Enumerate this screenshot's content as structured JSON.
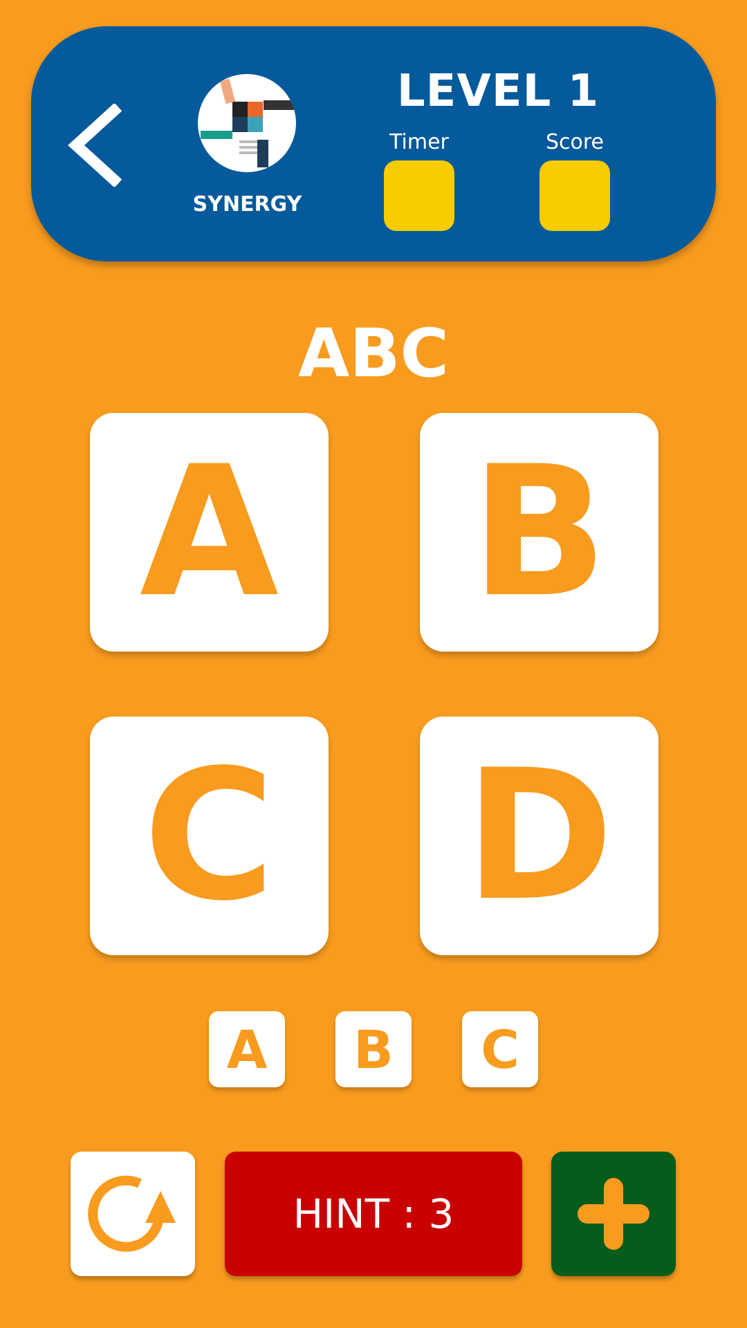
{
  "header": {
    "category_label": "SYNERGY",
    "level_title": "LEVEL 1",
    "timer_label": "Timer",
    "score_label": "Score",
    "timer_value": "",
    "score_value": ""
  },
  "question": {
    "word": "ABC"
  },
  "options": [
    "A",
    "B",
    "C",
    "D"
  ],
  "answer_slots": [
    "A",
    "B",
    "C"
  ],
  "controls": {
    "hint_label": "HINT : 3"
  },
  "icons": {
    "back": "chevron-left-icon",
    "refresh": "refresh-icon",
    "plus": "plus-icon",
    "category_image": "puzzle-hands-image"
  },
  "colors": {
    "background": "#f89b1e",
    "header": "#045a9a",
    "stat_box": "#f9cc00",
    "hint_button": "#c90000",
    "plus_button": "#065c1a"
  }
}
